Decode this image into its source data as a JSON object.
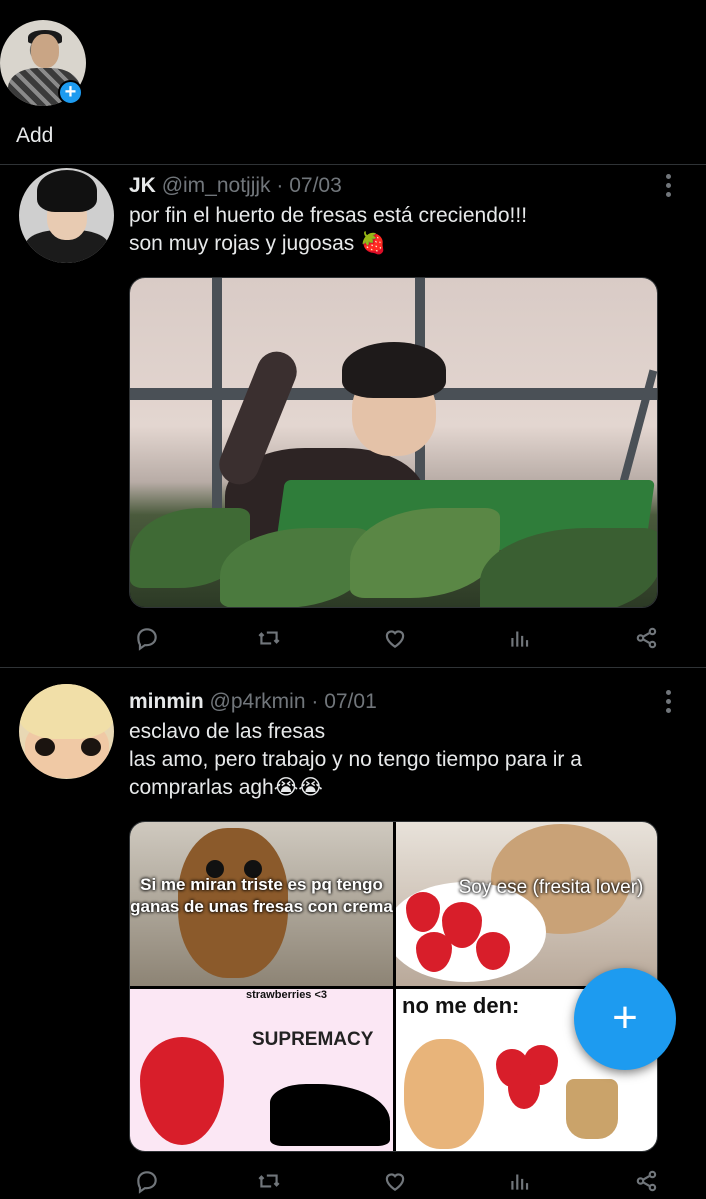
{
  "fleets": {
    "add_label": "Add"
  },
  "tweets": [
    {
      "name": "JK",
      "handle": "@im_notjjjk",
      "date": "· 07/03",
      "text": "por fin el huerto de fresas está creciendo!!!\nson muy rojas y jugosas 🍓"
    },
    {
      "name": "minmin",
      "handle": "@p4rkmin",
      "date": "· 07/01",
      "text": "esclavo de las fresas\nlas amo, pero trabajo y no tengo tiempo para ir a\ncomprarlas agh😭😭",
      "images": [
        {
          "caption": "Si me miran triste es pq tengo ganas de unas fresas con crema"
        },
        {
          "caption": "Soy ese (fresita lover)"
        },
        {
          "caption_top": "strawberries <3",
          "caption": "SUPREMACY"
        },
        {
          "caption": "no me den:"
        }
      ]
    }
  ],
  "icons": {
    "reply": "reply-icon",
    "retweet": "retweet-icon",
    "like": "heart-icon",
    "analytics": "analytics-icon",
    "share": "share-icon",
    "more": "more-icon"
  },
  "fab": {
    "symbol": "+"
  },
  "colors": {
    "accent": "#1d9bf0",
    "background": "#000000",
    "muted": "#71767b"
  }
}
